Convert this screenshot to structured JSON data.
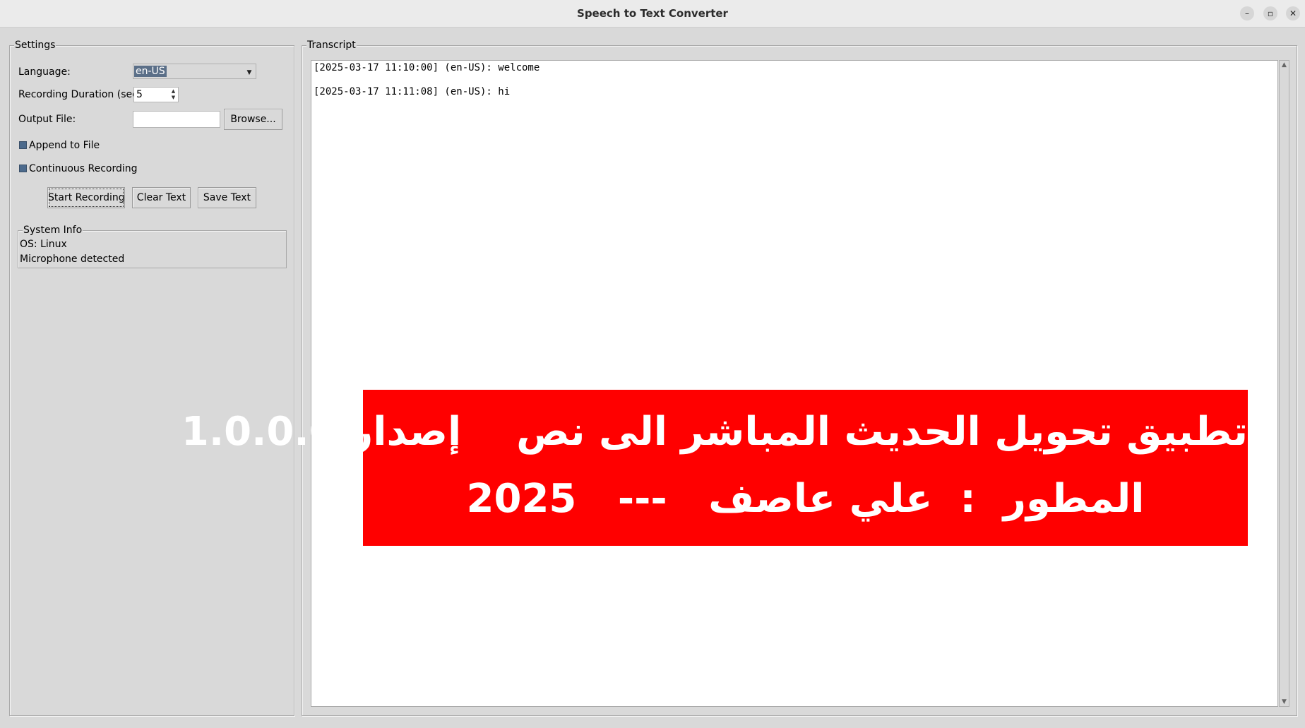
{
  "window": {
    "title": "Speech to Text Converter",
    "controls": {
      "minimize": "–",
      "maximize": "▫",
      "close": "✕"
    }
  },
  "settings": {
    "frame_label": "Settings",
    "language_label": "Language:",
    "language_value": "en-US",
    "duration_label": "Recording Duration (sec):",
    "duration_value": "5",
    "output_label": "Output File:",
    "output_value": "",
    "browse_label": "Browse...",
    "append_label": "Append to File",
    "continuous_label": "Continuous Recording",
    "start_label": "Start Recording",
    "clear_label": "Clear Text",
    "save_label": "Save Text"
  },
  "system_info": {
    "frame_label": "System Info",
    "os": "OS: Linux",
    "mic": "Microphone detected"
  },
  "transcript": {
    "frame_label": "Transcript",
    "lines": [
      "[2025-03-17 11:10:00] (en-US): welcome",
      "[2025-03-17 11:11:08] (en-US): hi"
    ]
  },
  "banner": {
    "line1": "تطبيق تحويل الحديث المباشر الى نص    إصدار 1.0.0.0",
    "line2": "المطور  :  علي عاصف   ---   2025",
    "background": "#ff0000",
    "text_color": "#ffffff"
  },
  "colors": {
    "window_bg": "#d9d9d9",
    "selection": "#5b6f88",
    "checkbox": "#4c6a8c"
  }
}
